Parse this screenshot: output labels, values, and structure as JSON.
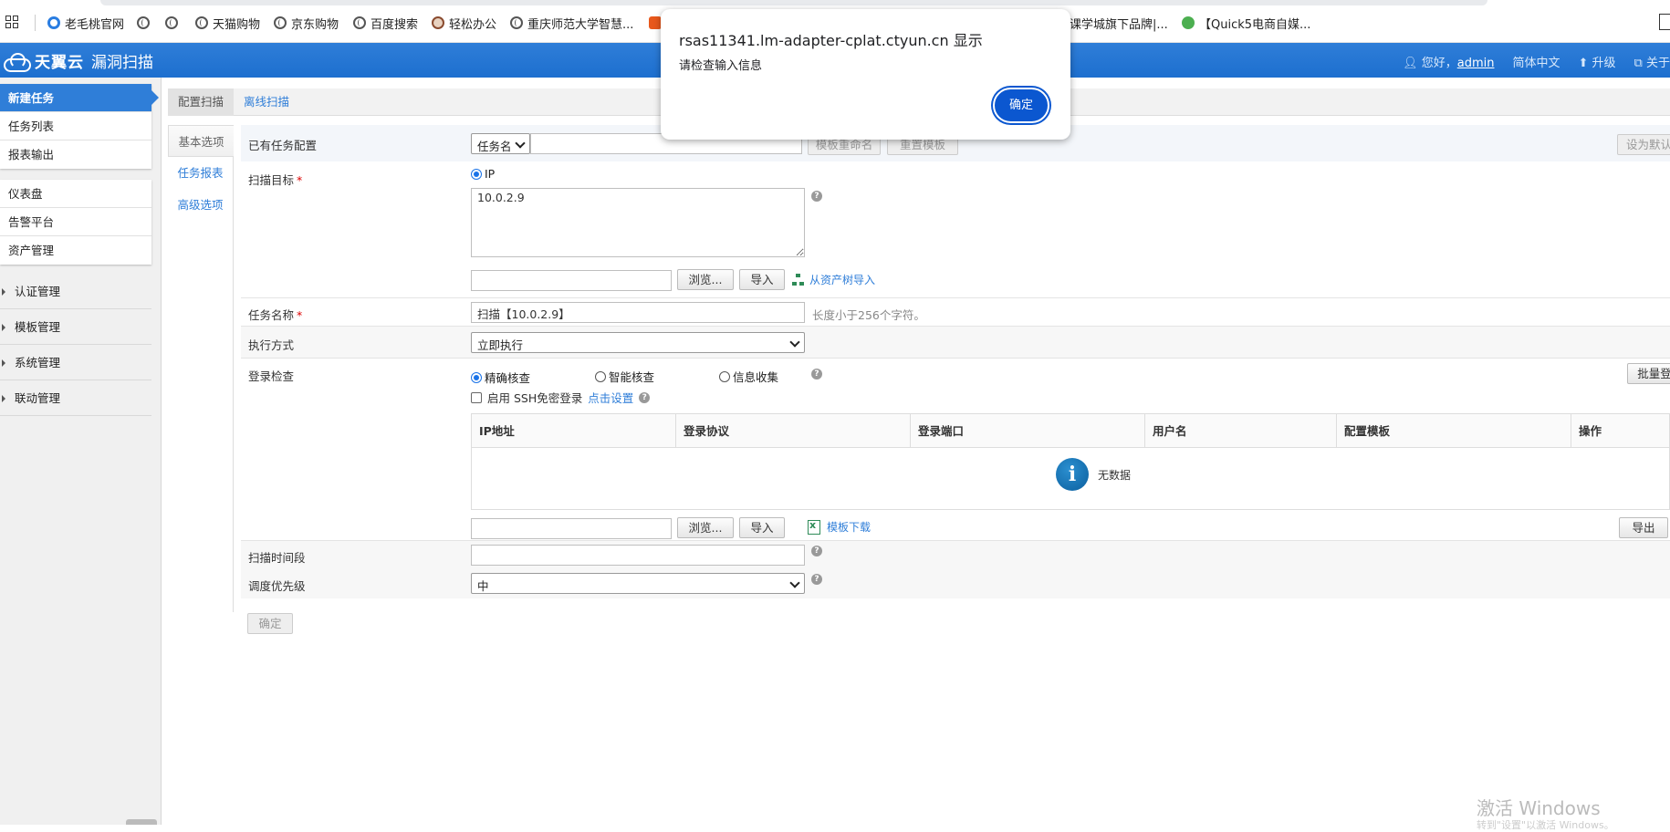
{
  "bookmarks": [
    {
      "label": "老毛桃官网",
      "color": "#2a7de1"
    },
    {
      "label": "",
      "color": ""
    },
    {
      "label": "",
      "color": ""
    },
    {
      "label": "天猫购物",
      "color": ""
    },
    {
      "label": "京东购物",
      "color": ""
    },
    {
      "label": "百度搜索",
      "color": ""
    },
    {
      "label": "轻松办公",
      "color": "#c0392b"
    },
    {
      "label": "重庆师范大学智慧...",
      "color": ""
    },
    {
      "label": "课学城旗下品牌|...",
      "color": ""
    },
    {
      "label": "【Quick5电商自媒...",
      "color": "#4caf50"
    }
  ],
  "header": {
    "brand": "天翼云",
    "product": "漏洞扫描",
    "greeting": "您好，",
    "user": "admin",
    "language": "简体中文",
    "upgrade": "升级",
    "about": "关于"
  },
  "sidebar": {
    "group1": [
      "新建任务",
      "任务列表",
      "报表输出"
    ],
    "group2": [
      "仪表盘",
      "告警平台",
      "资产管理"
    ],
    "sections": [
      "认证管理",
      "模板管理",
      "系统管理",
      "联动管理"
    ]
  },
  "tabs": {
    "config": "配置扫描",
    "offline": "离线扫描"
  },
  "side_tabs": [
    "基本选项",
    "任务报表",
    "高级选项"
  ],
  "form": {
    "existing_config_label": "已有任务配置",
    "task_name_select": "任务名",
    "template_rename": "模板重命名",
    "reset_template": "重置模板",
    "set_default": "设为默认",
    "scan_target_label": "扫描目标",
    "target_type": "IP",
    "target_value": "10.0.2.9",
    "browse": "浏览...",
    "import": "导入",
    "import_from_tree": "从资产树导入",
    "task_name_label": "任务名称",
    "task_name_value": "扫描【10.0.2.9】",
    "task_name_hint": "长度小于256个字符。",
    "exec_mode_label": "执行方式",
    "exec_mode_value": "立即执行",
    "login_check_label": "登录检查",
    "login_opts": [
      "精确核查",
      "智能核查",
      "信息收集"
    ],
    "batch_login": "批量登",
    "ssh_enable": "启用 SSH免密登录",
    "ssh_setup": "点击设置",
    "table_headers": [
      "IP地址",
      "登录协议",
      "登录端口",
      "用户名",
      "配置模板",
      "操作"
    ],
    "no_data": "无数据",
    "template_download": "模板下载",
    "export": "导出",
    "time_range_label": "扫描时间段",
    "priority_label": "调度优先级",
    "priority_value": "中",
    "submit": "确定"
  },
  "dialog": {
    "title": "rsas11341.lm-adapter-cplat.ctyun.cn 显示",
    "message": "请检查输入信息",
    "ok": "确定"
  },
  "watermark": {
    "line1": "激活 Windows",
    "line2": "转到\"设置\"以激活 Windows。"
  }
}
